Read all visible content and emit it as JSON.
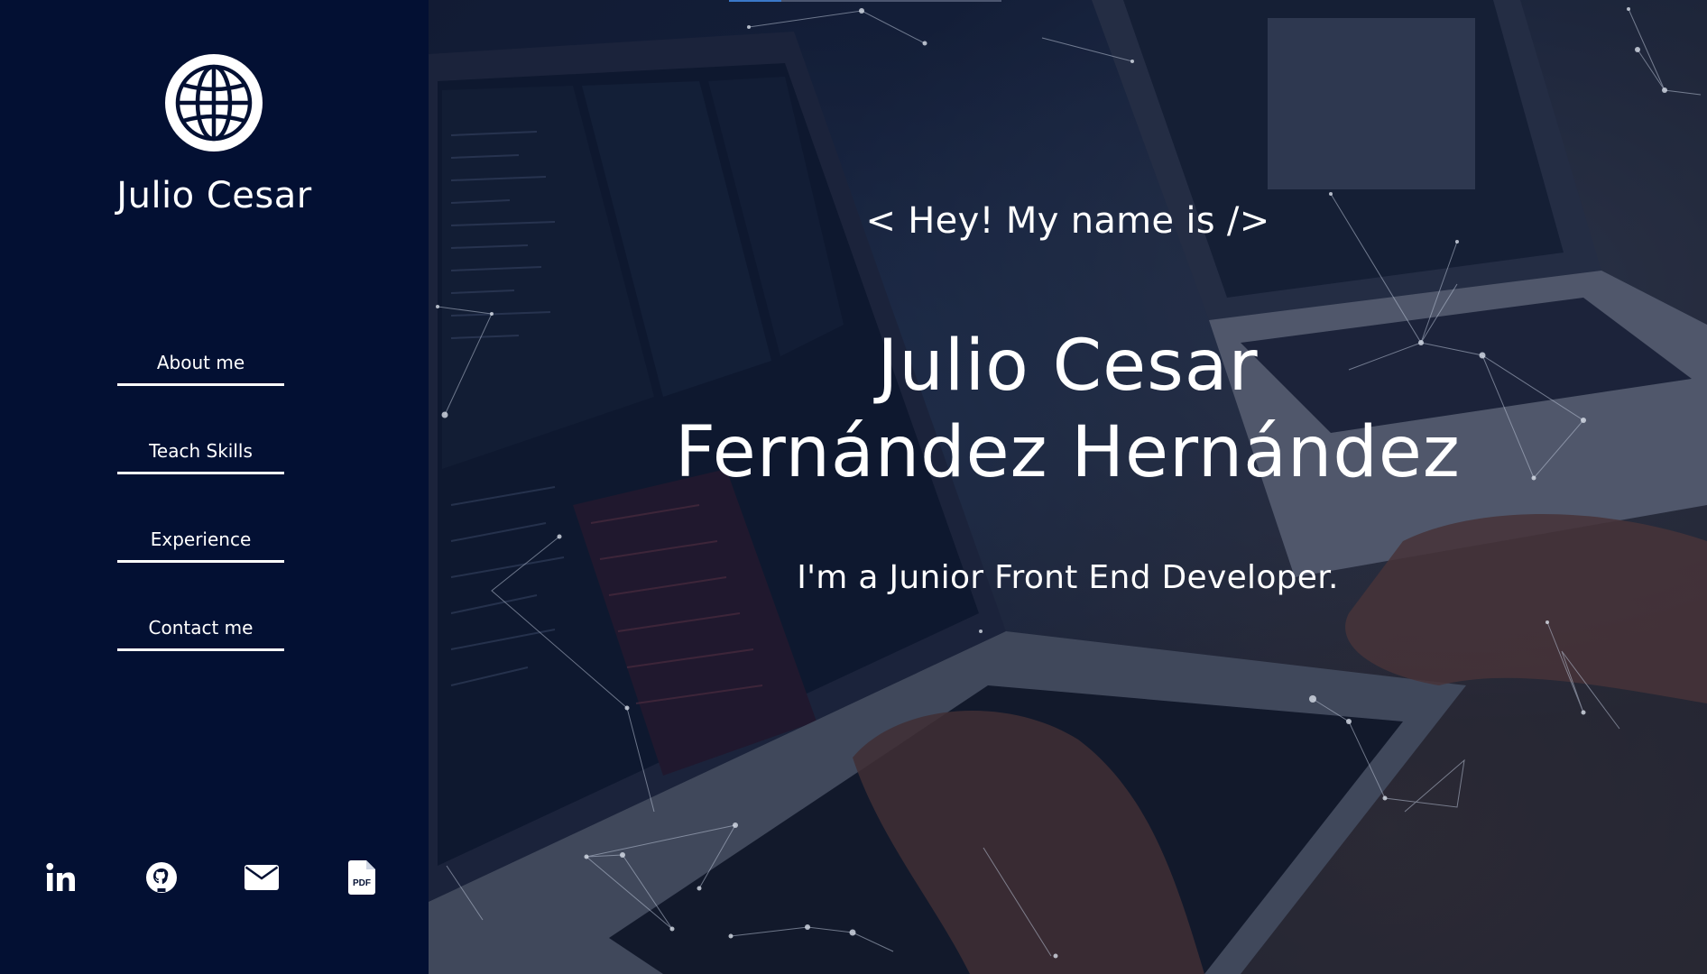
{
  "sidebar": {
    "logo_icon": "globe-icon",
    "name": "Julio Cesar",
    "nav": [
      {
        "label": "About me"
      },
      {
        "label": "Teach Skills"
      },
      {
        "label": "Experience"
      },
      {
        "label": "Contact me"
      }
    ],
    "socials": [
      {
        "icon": "linkedin-icon"
      },
      {
        "icon": "github-icon"
      },
      {
        "icon": "mail-icon"
      },
      {
        "icon": "pdf-file-icon"
      }
    ]
  },
  "hero": {
    "greeting": "< Hey! My name is />",
    "name_line1": "Julio Cesar",
    "name_line2": "Fernández Hernández",
    "tagline": "I'm a Junior Front End Developer.",
    "background": "laptop-coding-photo"
  },
  "colors": {
    "sidebar_bg": "#031033",
    "text": "#ffffff",
    "accent": "#3a78c9"
  }
}
